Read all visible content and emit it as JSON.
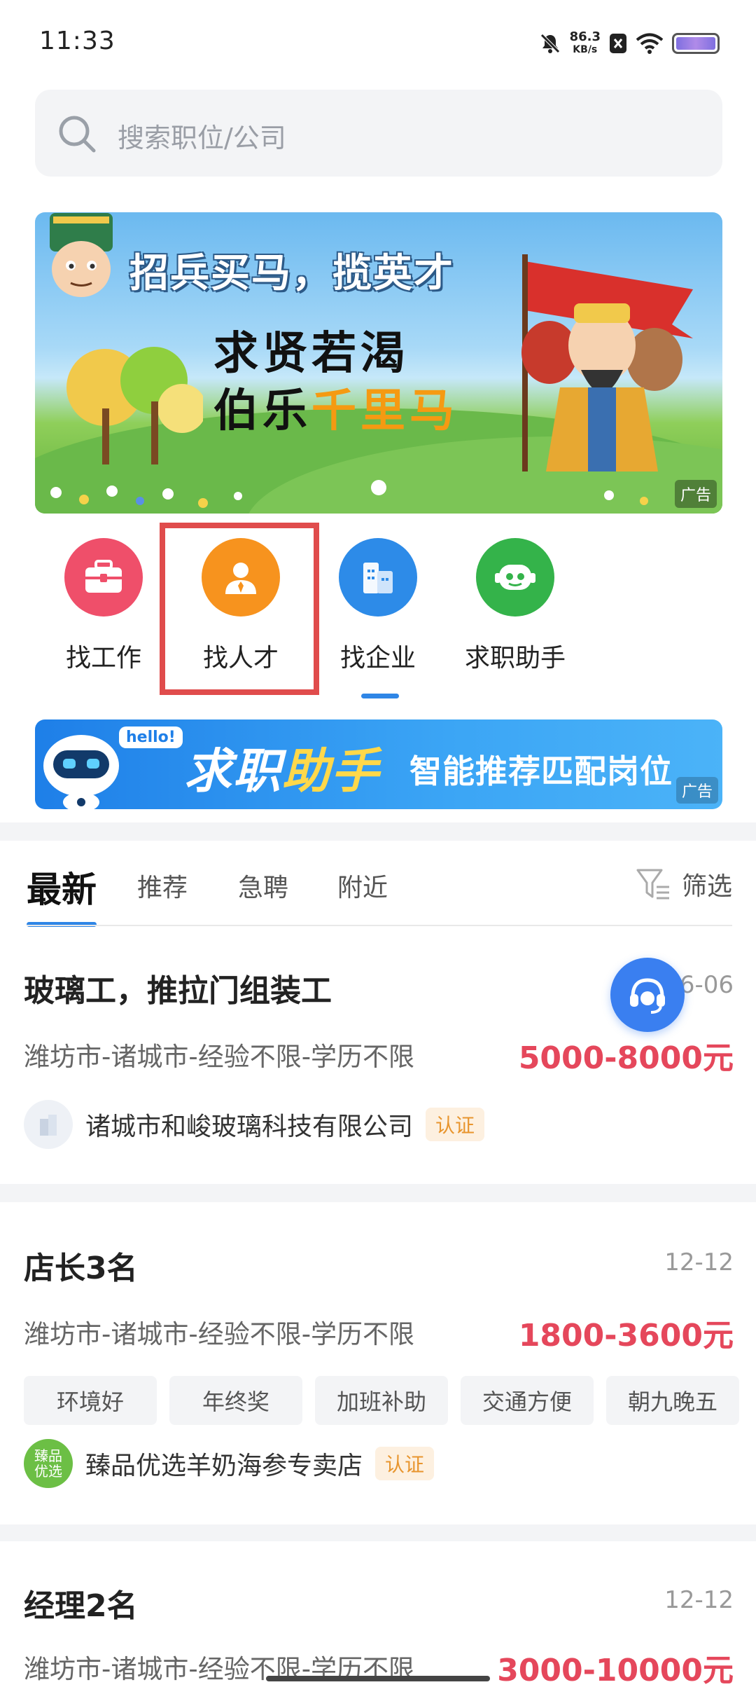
{
  "status_bar": {
    "time": "11:33",
    "net_speed": "86.3",
    "net_unit": "KB/s"
  },
  "search": {
    "placeholder": "搜索职位/公司"
  },
  "banner": {
    "title": "招兵买马，揽英才",
    "line1": "求贤若渴",
    "line2_prefix": "伯乐",
    "line2_highlight": "千里马",
    "ad_tag": "广告"
  },
  "quick_nav": [
    {
      "label": "找工作",
      "icon": "briefcase-icon",
      "color": "#ef4f6a"
    },
    {
      "label": "找人才",
      "icon": "person-icon",
      "color": "#f7931e"
    },
    {
      "label": "找企业",
      "icon": "building-icon",
      "color": "#2d8be8"
    },
    {
      "label": "求职助手",
      "icon": "robot-icon",
      "color": "#34b34a"
    }
  ],
  "assistant_ad": {
    "hello": "hello!",
    "title_white": "求职",
    "title_yellow": "助手",
    "subtitle": "智能推荐匹配岗位",
    "ad_tag": "广告"
  },
  "tabs": {
    "active": "最新",
    "items": [
      "推荐",
      "急聘",
      "附近"
    ],
    "filter": "筛选"
  },
  "jobs": [
    {
      "title": "玻璃工，推拉门组装工",
      "date": "6-06",
      "meta": "潍坊市-诸城市-经验不限-学历不限",
      "salary": "5000-8000元",
      "company": "诸城市和峻玻璃科技有限公司",
      "verified": "认证",
      "tags": []
    },
    {
      "title": "店长3名",
      "date": "12-12",
      "meta": "潍坊市-诸城市-经验不限-学历不限",
      "salary": "1800-3600元",
      "company": "臻品优选羊奶海参专卖店",
      "company_logo_text": "臻品优选",
      "verified": "认证",
      "tags": [
        "环境好",
        "年终奖",
        "加班补助",
        "交通方便",
        "朝九晚五"
      ]
    },
    {
      "title": "经理2名",
      "date": "12-12",
      "meta": "潍坊市-诸城市-经验不限-学历不限",
      "salary": "3000-10000元"
    }
  ]
}
